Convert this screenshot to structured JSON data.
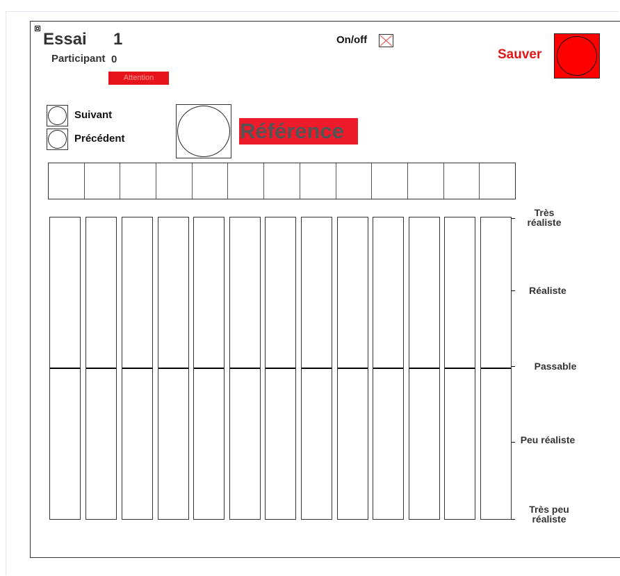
{
  "header": {
    "essai_label": "Essai",
    "essai_number": "1",
    "participant_label": "Participant",
    "participant_number": "0",
    "attention_label": "Attention"
  },
  "toggle": {
    "label": "On/off",
    "checked": false
  },
  "save": {
    "label": "Sauver"
  },
  "navigation": {
    "next_label": "Suivant",
    "previous_label": "Précédent"
  },
  "reference": {
    "label": "Référence"
  },
  "stimulus_buttons": {
    "count": 13
  },
  "sliders": {
    "count": 13,
    "values": [
      0.5,
      0.5,
      0.5,
      0.5,
      0.5,
      0.5,
      0.5,
      0.5,
      0.5,
      0.5,
      0.5,
      0.5,
      0.5
    ]
  },
  "scale": {
    "labels": [
      "Très réaliste",
      "Réaliste",
      "Passable",
      "Peu réaliste",
      "Très peu réaliste"
    ]
  },
  "colors": {
    "accent_red": "#ff0000",
    "attention_red": "#e8141b",
    "reference_red": "#ee1c2a",
    "save_text_red": "#e01515"
  }
}
